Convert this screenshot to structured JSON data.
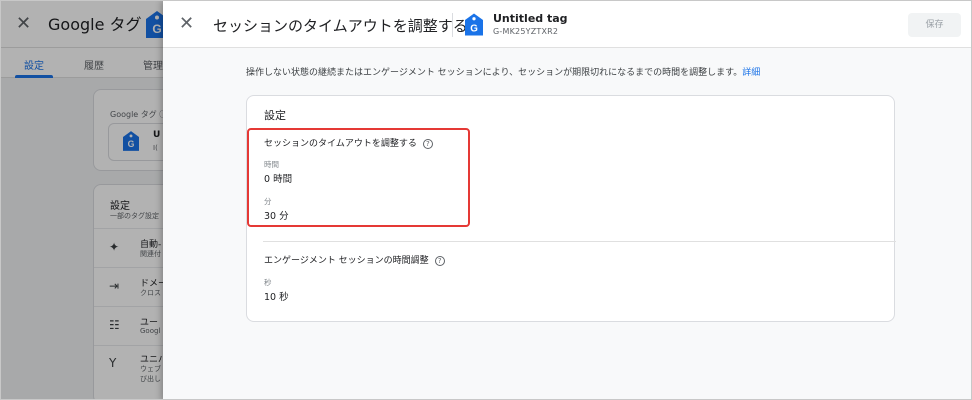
{
  "background_app": {
    "close_glyph": "✕",
    "title": "Google タグ",
    "tabs": [
      "設定",
      "履歴",
      "管理"
    ],
    "tag_card": {
      "label": "Google タグ ⓘ",
      "name_fragment": "U",
      "id_fragment": "I("
    },
    "settings_card": {
      "title": "設定",
      "subtitle": "一部のタグ設定",
      "rows": [
        {
          "icon": "sparkle-icon",
          "glyph": "✦",
          "title": "自動-",
          "sub": "関連付"
        },
        {
          "icon": "domains-icon",
          "glyph": "⇥",
          "title": "ドメー",
          "sub": "クロス"
        },
        {
          "icon": "user-provided-data-icon",
          "glyph": "☷",
          "title": "ユー",
          "sub": "Googl"
        },
        {
          "icon": "universal-icon",
          "glyph": "Y",
          "title": "ユニバ",
          "sub": "ウェブ"
        }
      ],
      "extra_text": "び出し"
    }
  },
  "panel": {
    "close_glyph": "✕",
    "title": "セッションのタイムアウトを調整する",
    "tag_name": "Untitled tag",
    "tag_id": "G-MK25YZTXR2",
    "save_label": "保存",
    "description": "操作しない状態の継続またはエンゲージメント セッションにより、セッションが期限切れになるまでの時間を調整します。",
    "description_link": "詳細",
    "card": {
      "title": "設定",
      "session_timeout": {
        "label": "セッションのタイムアウトを調整する",
        "hours_label": "時間",
        "hours_value": "0  時間",
        "minutes_label": "分",
        "minutes_value": "30  分"
      },
      "engaged_session": {
        "label": "エンゲージメント セッションの時間調整",
        "seconds_label": "秒",
        "seconds_value": "10  秒"
      }
    }
  },
  "colors": {
    "accent": "#1a73e8",
    "highlight": "#e53935",
    "tag_icon": "#1a73e8"
  }
}
